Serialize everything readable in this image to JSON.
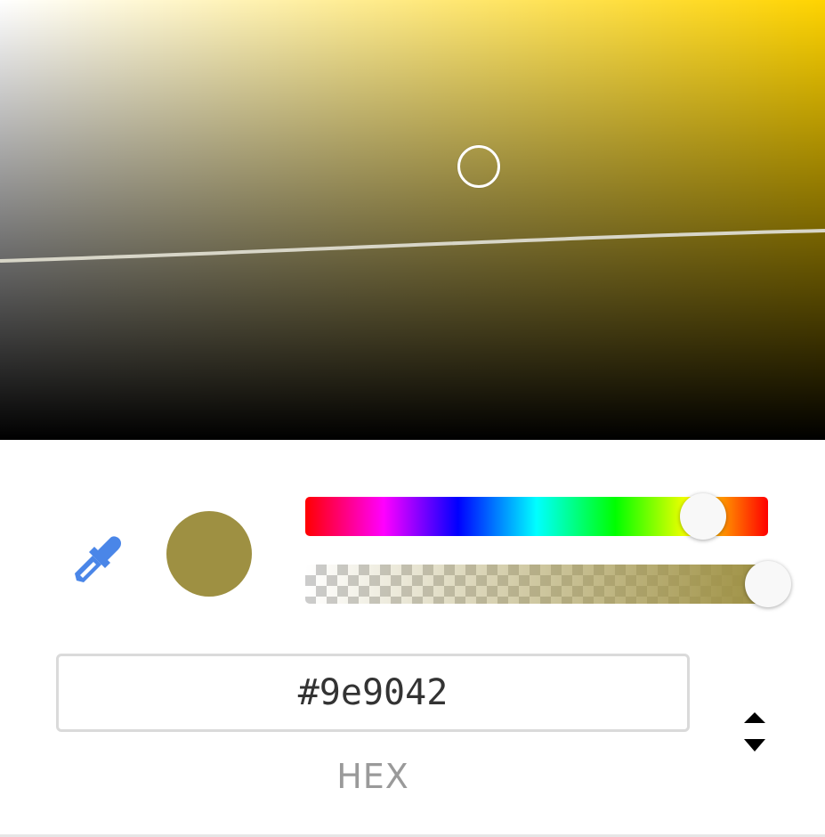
{
  "picker": {
    "hue_color": "#ffd400",
    "current_color": "#9e9042",
    "hue_position": 0.86,
    "alpha": 1.0,
    "saturation_pointer": {
      "saturation": 0.58,
      "value": 0.62
    }
  },
  "icons": {
    "eyedropper": "eyedropper-icon",
    "mode_toggle": "up-down-arrows-icon"
  },
  "hex_input": {
    "value": "#9e9042",
    "label": "HEX"
  },
  "colors": {
    "accent": "#4a86e8",
    "input_border": "#dadada",
    "label": "#9a9a9a"
  }
}
